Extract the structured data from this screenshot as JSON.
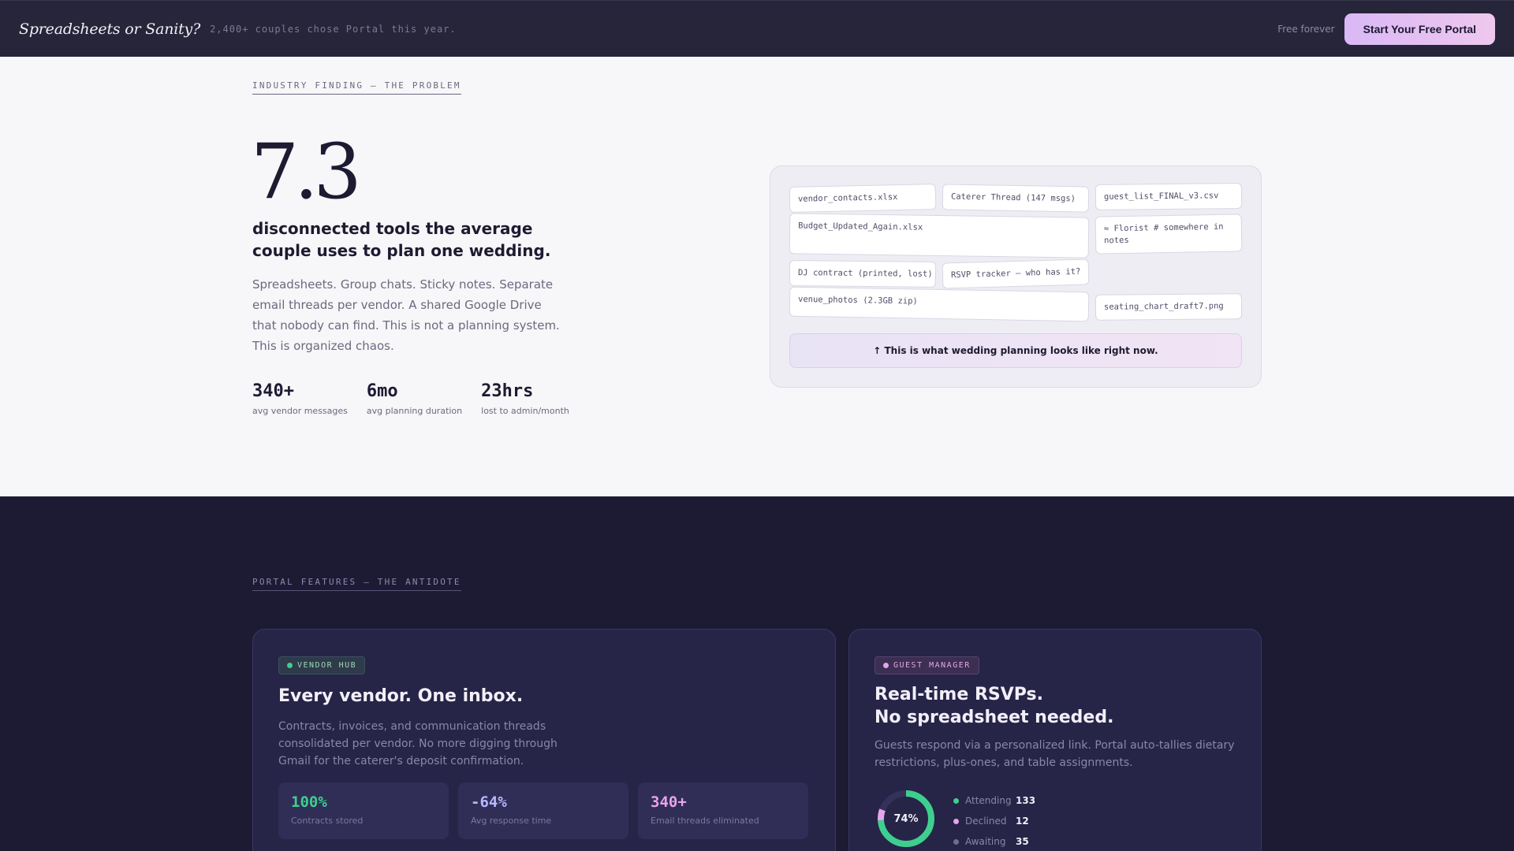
{
  "topbar": {
    "brand": "Spreadsheets or Sanity?",
    "tagline": "2,400+ couples chose Portal this year.",
    "free_note": "Free forever",
    "cta_label": "Start Your Free Portal"
  },
  "problem": {
    "eyebrow": "INDUSTRY FINDING — THE PROBLEM",
    "big_number": "7.3",
    "headline": "disconnected tools the average couple uses to plan one wedding.",
    "body": "Spreadsheets. Group chats. Sticky notes. Separate email threads per vendor. A shared Google Drive that nobody can find. This is not a planning system. This is organized chaos.",
    "stats": [
      {
        "value": "340+",
        "label": "avg vendor messages"
      },
      {
        "value": "6mo",
        "label": "avg planning duration"
      },
      {
        "value": "23hrs",
        "label": "lost to admin/month"
      }
    ],
    "chips": [
      "vendor_contacts.xlsx",
      "Caterer Thread (147 msgs)",
      "guest_list_FINAL_v3.csv",
      "Budget_Updated_Again.xlsx",
      "≈ Florist # somewhere in notes",
      "DJ contract (printed, lost)",
      "RSVP tracker — who has it?",
      "venue_photos (2.3GB zip)",
      "seating_chart_draft7.png"
    ],
    "caption": "↑ This is what wedding planning looks like right now."
  },
  "features": {
    "eyebrow": "PORTAL FEATURES — THE ANTIDOTE",
    "vendor": {
      "badge": "VENDOR HUB",
      "title": "Every vendor. One inbox.",
      "body": "Contracts, invoices, and communication threads consolidated per vendor. No more digging through Gmail for the caterer's deposit confirmation.",
      "metrics": [
        {
          "value": "100%",
          "label": "Contracts stored",
          "color": "#3ecf8e"
        },
        {
          "value": "-64%",
          "label": "Avg response time",
          "color": "#b9b6ff"
        },
        {
          "value": "340+",
          "label": "Email threads eliminated",
          "color": "#e7a3ec"
        }
      ]
    },
    "guest": {
      "badge": "GUEST MANAGER",
      "title_line1": "Real-time RSVPs.",
      "title_line2": "No spreadsheet needed.",
      "body": "Guests respond via a personalized link. Portal auto-tallies dietary restrictions, plus-ones, and table assignments.",
      "donut_label": "74%",
      "rsvp": [
        {
          "name": "Attending",
          "value": 133,
          "color": "#3ecf8e"
        },
        {
          "name": "Declined",
          "value": 12,
          "color": "#e7a3ec"
        },
        {
          "name": "Awaiting",
          "value": 35,
          "color": "#6f6c8c"
        }
      ]
    }
  }
}
